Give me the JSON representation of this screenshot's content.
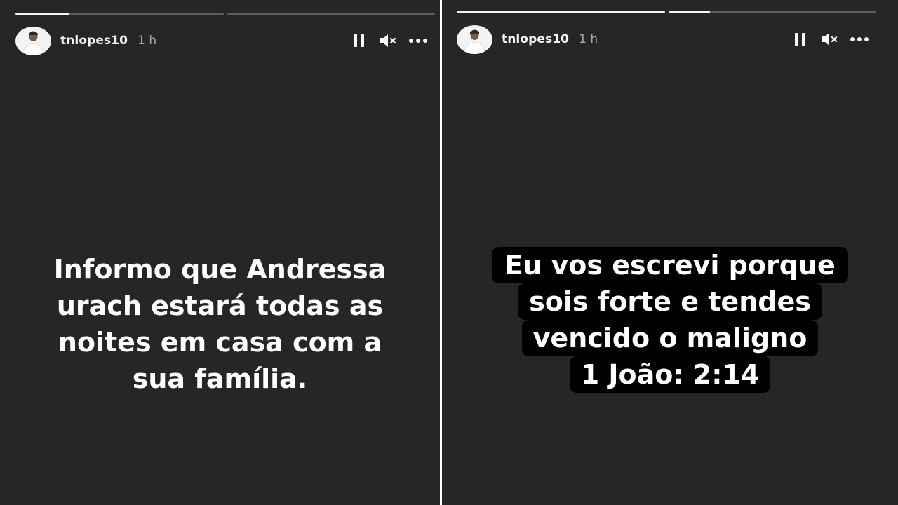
{
  "stories": [
    {
      "username": "tnlopes10",
      "time": "1 h",
      "progress": [
        0.26,
        0
      ],
      "text": "Informo que Andressa\nurach estará todas as\nnoites em casa com a\nsua família.",
      "controls": [
        "pause-icon",
        "mute-icon",
        "more-icon"
      ]
    },
    {
      "username": "tnlopes10",
      "time": "1 h",
      "progress": [
        1,
        0.2
      ],
      "caption_lines": [
        "Eu vos escrevi porque",
        "sois forte e tendes",
        "vencido o maligno",
        "1 João: 2:14"
      ],
      "controls": [
        "pause-icon",
        "mute-icon",
        "more-icon"
      ]
    }
  ],
  "colors": {
    "background": "#262626",
    "divider": "#ffffff",
    "text": "#ffffff",
    "progress_track": "#5c5c5c",
    "progress_fill": "#f2f2f2",
    "caption_background": "#000000"
  }
}
